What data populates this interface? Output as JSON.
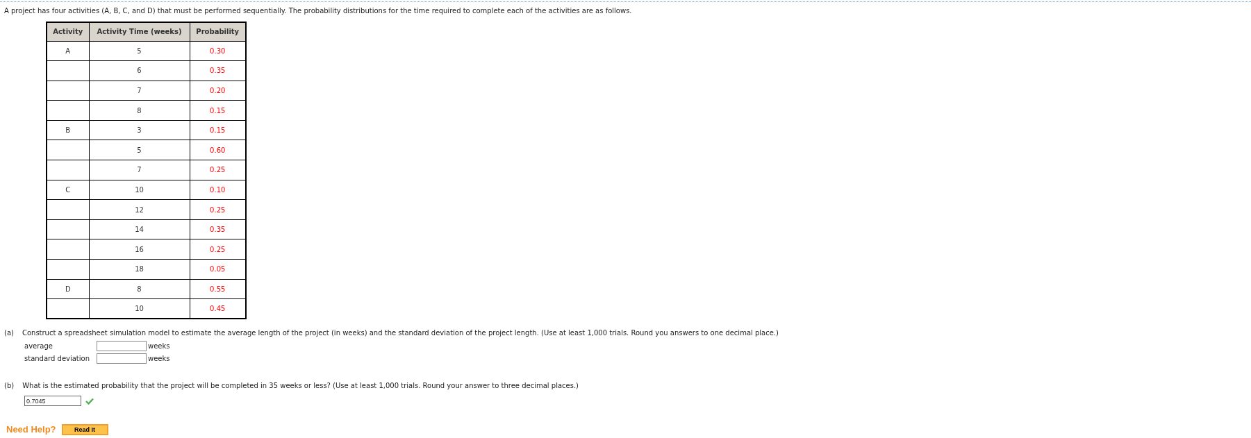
{
  "intro": "A project has four activities (A, B, C, and D) that must be performed sequentially. The probability distributions for the time required to complete each of the activities are as follows.",
  "table": {
    "columns": [
      "Activity",
      "Activity Time (weeks)",
      "Probability"
    ],
    "rows": [
      {
        "activity": "A",
        "time": "5",
        "probability": "0.30"
      },
      {
        "time": "6",
        "probability": "0.35"
      },
      {
        "time": "7",
        "probability": "0.20"
      },
      {
        "time": "8",
        "probability": "0.15"
      },
      {
        "activity": "B",
        "time": "3",
        "probability": "0.15"
      },
      {
        "time": "5",
        "probability": "0.60"
      },
      {
        "time": "7",
        "probability": "0.25"
      },
      {
        "activity": "C",
        "time": "10",
        "probability": "0.10"
      },
      {
        "time": "12",
        "probability": "0.25"
      },
      {
        "time": "14",
        "probability": "0.35"
      },
      {
        "time": "16",
        "probability": "0.25"
      },
      {
        "time": "18",
        "probability": "0.05"
      },
      {
        "activity": "D",
        "time": "8",
        "probability": "0.55"
      },
      {
        "time": "10",
        "probability": "0.45"
      }
    ]
  },
  "part_a": {
    "label": "(a)",
    "text": "Construct a spreadsheet simulation model to estimate the average length of the project (in weeks) and the standard deviation of the project length. (Use at least 1,000 trials. Round you answers to one decimal place.)",
    "fields": [
      {
        "label": "average",
        "unit": "weeks"
      },
      {
        "label": "standard deviation",
        "unit": "weeks"
      }
    ]
  },
  "part_b": {
    "label": "(b)",
    "text": "What is the estimated probability that the project will be completed in 35 weeks or less? (Use at least 1,000 trials. Round your answer to three decimal places.)",
    "answer": {
      "value": "0.7045",
      "correct": true
    }
  },
  "help": {
    "label": "Need Help?",
    "button": "Read It"
  }
}
